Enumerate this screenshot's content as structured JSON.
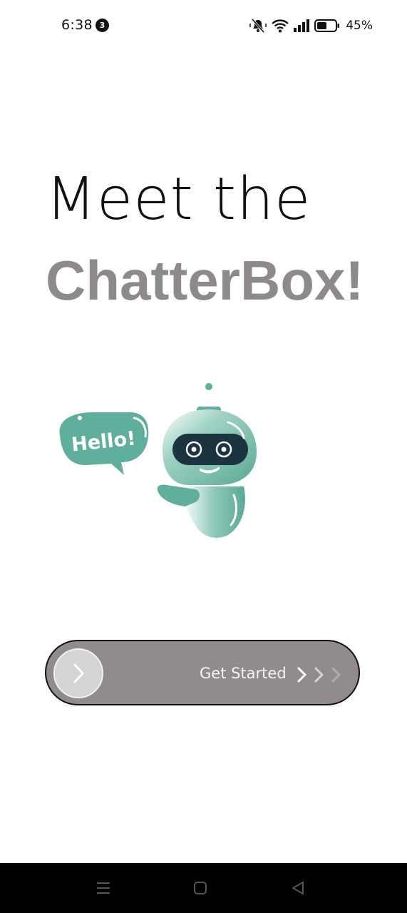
{
  "status_bar": {
    "time": "6:38",
    "notification_count": "3",
    "battery": "45%",
    "icons": [
      "mute-icon",
      "wifi-icon",
      "signal-icon",
      "battery-icon"
    ]
  },
  "headline": {
    "line1": "Meet the",
    "line2": "ChatterBox!"
  },
  "illustration": {
    "speech_bubble": "Hello!",
    "colors": {
      "teal": "#5faf9c",
      "visor": "#1b3440"
    }
  },
  "slider": {
    "label": "Get Started",
    "track_color": "#918b8b",
    "knob_color": "#d4d4d4"
  },
  "nav_bar": {
    "buttons": [
      "menu-icon",
      "home-icon",
      "back-icon"
    ]
  }
}
